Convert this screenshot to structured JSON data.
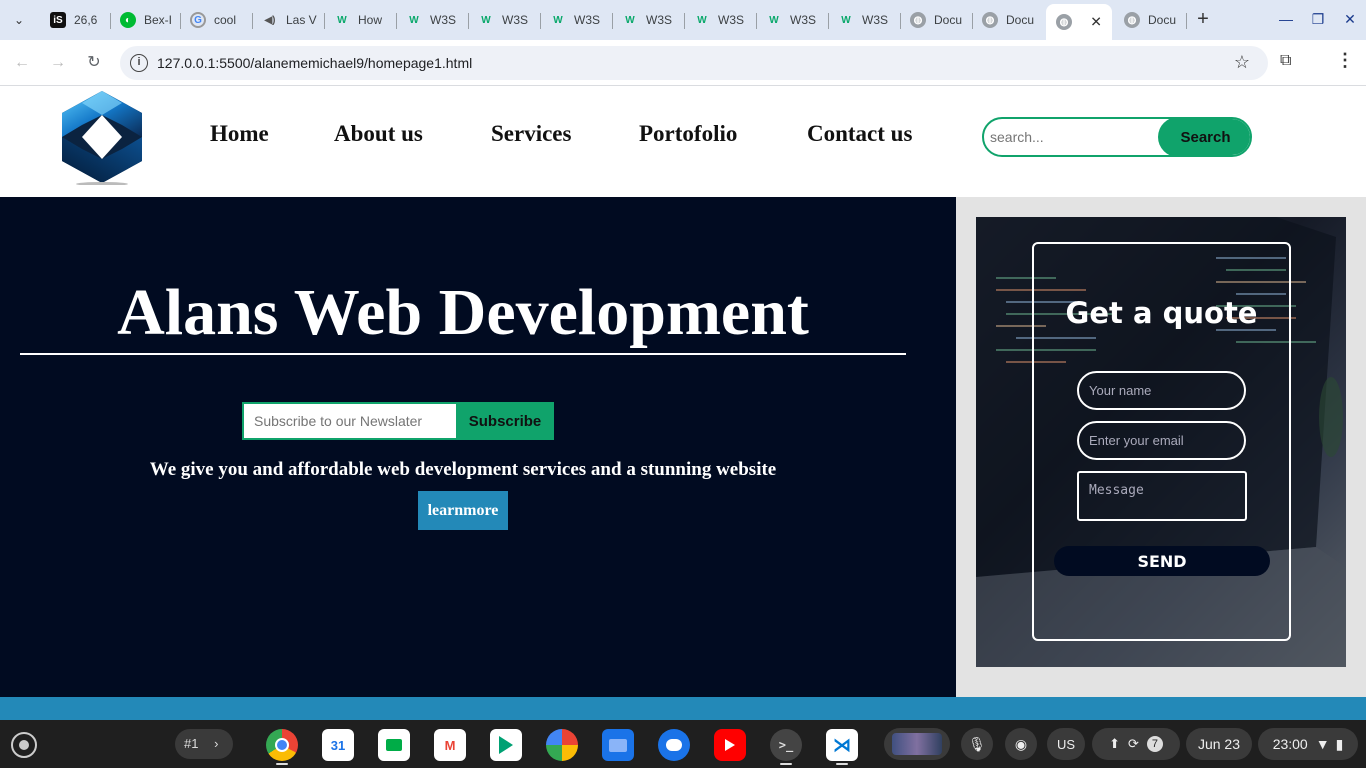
{
  "browser": {
    "tabs": [
      {
        "label": "26,6",
        "icon": "is-icon",
        "active": false
      },
      {
        "label": "Bex-I",
        "icon": "bex-icon",
        "active": false
      },
      {
        "label": "cool",
        "icon": "google-icon",
        "active": false
      },
      {
        "label": "Las V",
        "icon": "audio-icon",
        "active": false
      },
      {
        "label": "How",
        "icon": "w3schools-icon",
        "active": false
      },
      {
        "label": "W3S",
        "icon": "w3schools-icon",
        "active": false
      },
      {
        "label": "W3S",
        "icon": "w3schools-icon",
        "active": false
      },
      {
        "label": "W3S",
        "icon": "w3schools-icon",
        "active": false
      },
      {
        "label": "W3S",
        "icon": "w3schools-icon",
        "active": false
      },
      {
        "label": "W3S",
        "icon": "w3schools-icon",
        "active": false
      },
      {
        "label": "W3S",
        "icon": "w3schools-icon",
        "active": false
      },
      {
        "label": "W3S",
        "icon": "w3schools-icon",
        "active": false
      },
      {
        "label": "Docu",
        "icon": "globe-icon",
        "active": false
      },
      {
        "label": "Docu",
        "icon": "globe-icon",
        "active": false
      },
      {
        "label": "",
        "icon": "globe-icon",
        "active": true
      },
      {
        "label": "Docu",
        "icon": "globe-icon",
        "active": false
      }
    ],
    "url": "127.0.0.1:5500/alanememichael9/homepage1.html"
  },
  "site": {
    "nav": [
      "Home",
      "About us",
      "Services",
      "Portofolio",
      "Contact us"
    ],
    "search": {
      "placeholder": "search...",
      "button": "Search"
    },
    "hero": {
      "title": "Alans Web Development",
      "subscribe_placeholder": "Subscribe to our Newslater",
      "subscribe_button": "Subscribe",
      "tagline": "We give you and affordable web development services and a stunning website",
      "learn_button": "learnmore"
    },
    "quote": {
      "title": "Get a quote",
      "name_placeholder": "Your name",
      "email_placeholder": "Enter your email",
      "message_placeholder": "Message",
      "send_button": "SEND"
    },
    "colors": {
      "hero_bg": "#010b21",
      "accent_green": "#10a36b",
      "accent_blue": "#2389b8"
    }
  },
  "shelf": {
    "desk_label": "#1",
    "apps": [
      "chrome-icon",
      "calendar-icon",
      "meet-icon",
      "gmail-icon",
      "play-store-icon",
      "photos-icon",
      "files-icon",
      "messages-icon",
      "youtube-icon",
      "terminal-icon",
      "vscode-icon"
    ],
    "calendar_day": "31",
    "tray": {
      "input_method": "US",
      "notification_count": "7",
      "date": "Jun 23",
      "time": "23:00"
    }
  }
}
